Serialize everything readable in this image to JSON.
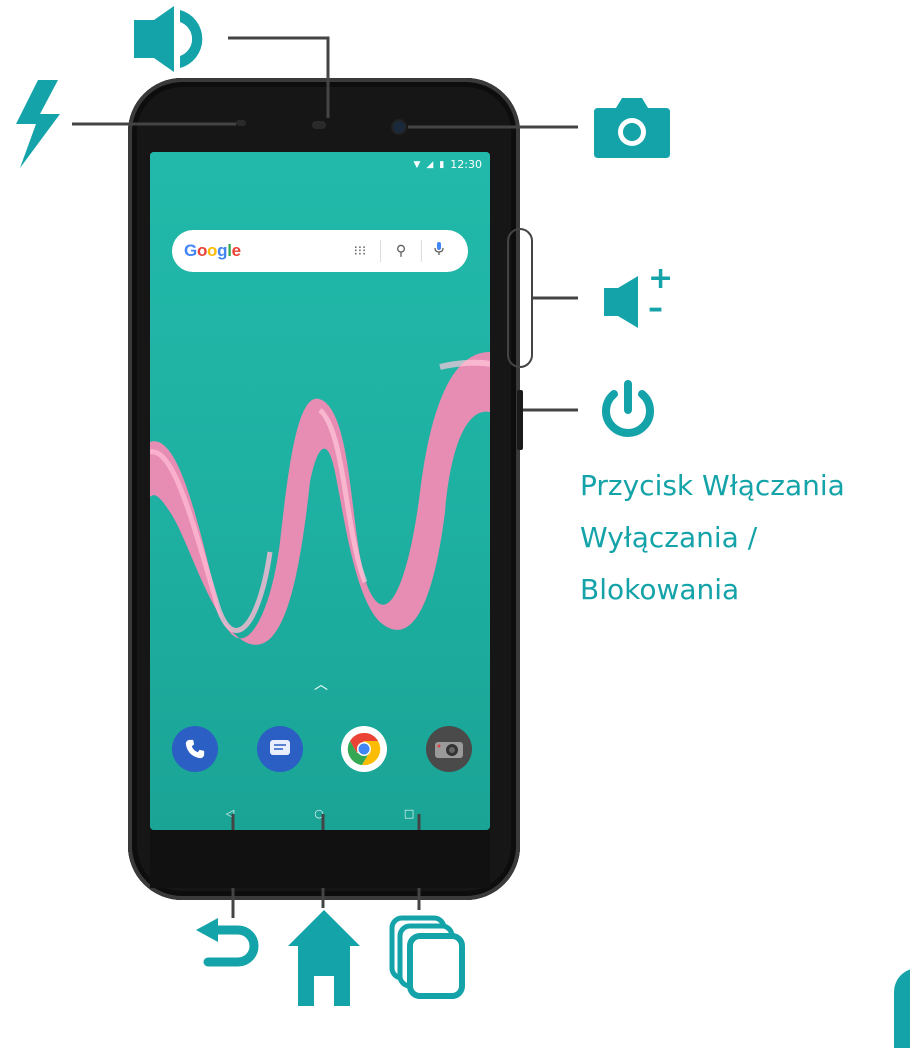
{
  "status_bar": {
    "time": "12:30",
    "wifi_icon": "wifi-icon",
    "signal_icon": "signal-icon",
    "battery_icon": "battery-icon"
  },
  "search_bar": {
    "logo_text": "Google",
    "apps_icon": "apps-grid-icon",
    "search_icon": "search-icon",
    "mic_icon": "microphone-icon"
  },
  "dock_apps": [
    {
      "name": "phone",
      "icon": "phone-icon",
      "color": "#2b5fc4"
    },
    {
      "name": "messages",
      "icon": "message-icon",
      "color": "#2b5fc4"
    },
    {
      "name": "chrome",
      "icon": "chrome-icon",
      "color": "#ffffff"
    },
    {
      "name": "camera",
      "icon": "camera-app-icon",
      "color": "#555555"
    }
  ],
  "nav_buttons": [
    "◁",
    "○",
    "□"
  ],
  "callouts": {
    "speaker": "speaker-icon",
    "flash": "flash-icon",
    "front_camera": "camera-icon",
    "volume": "volume-icon",
    "volume_plus": "+",
    "volume_minus": "–",
    "power": "power-icon",
    "back": "back-icon",
    "home": "home-icon",
    "recent_apps": "recent-apps-icon"
  },
  "power_caption": {
    "line1": "Przycisk Włączania",
    "line2": "Wyłączania /",
    "line3": "Blokowania"
  },
  "colors": {
    "accent": "#13a3a8",
    "screen": "#20b6a6",
    "wallpaper_ribbon": "#f28ab3"
  }
}
